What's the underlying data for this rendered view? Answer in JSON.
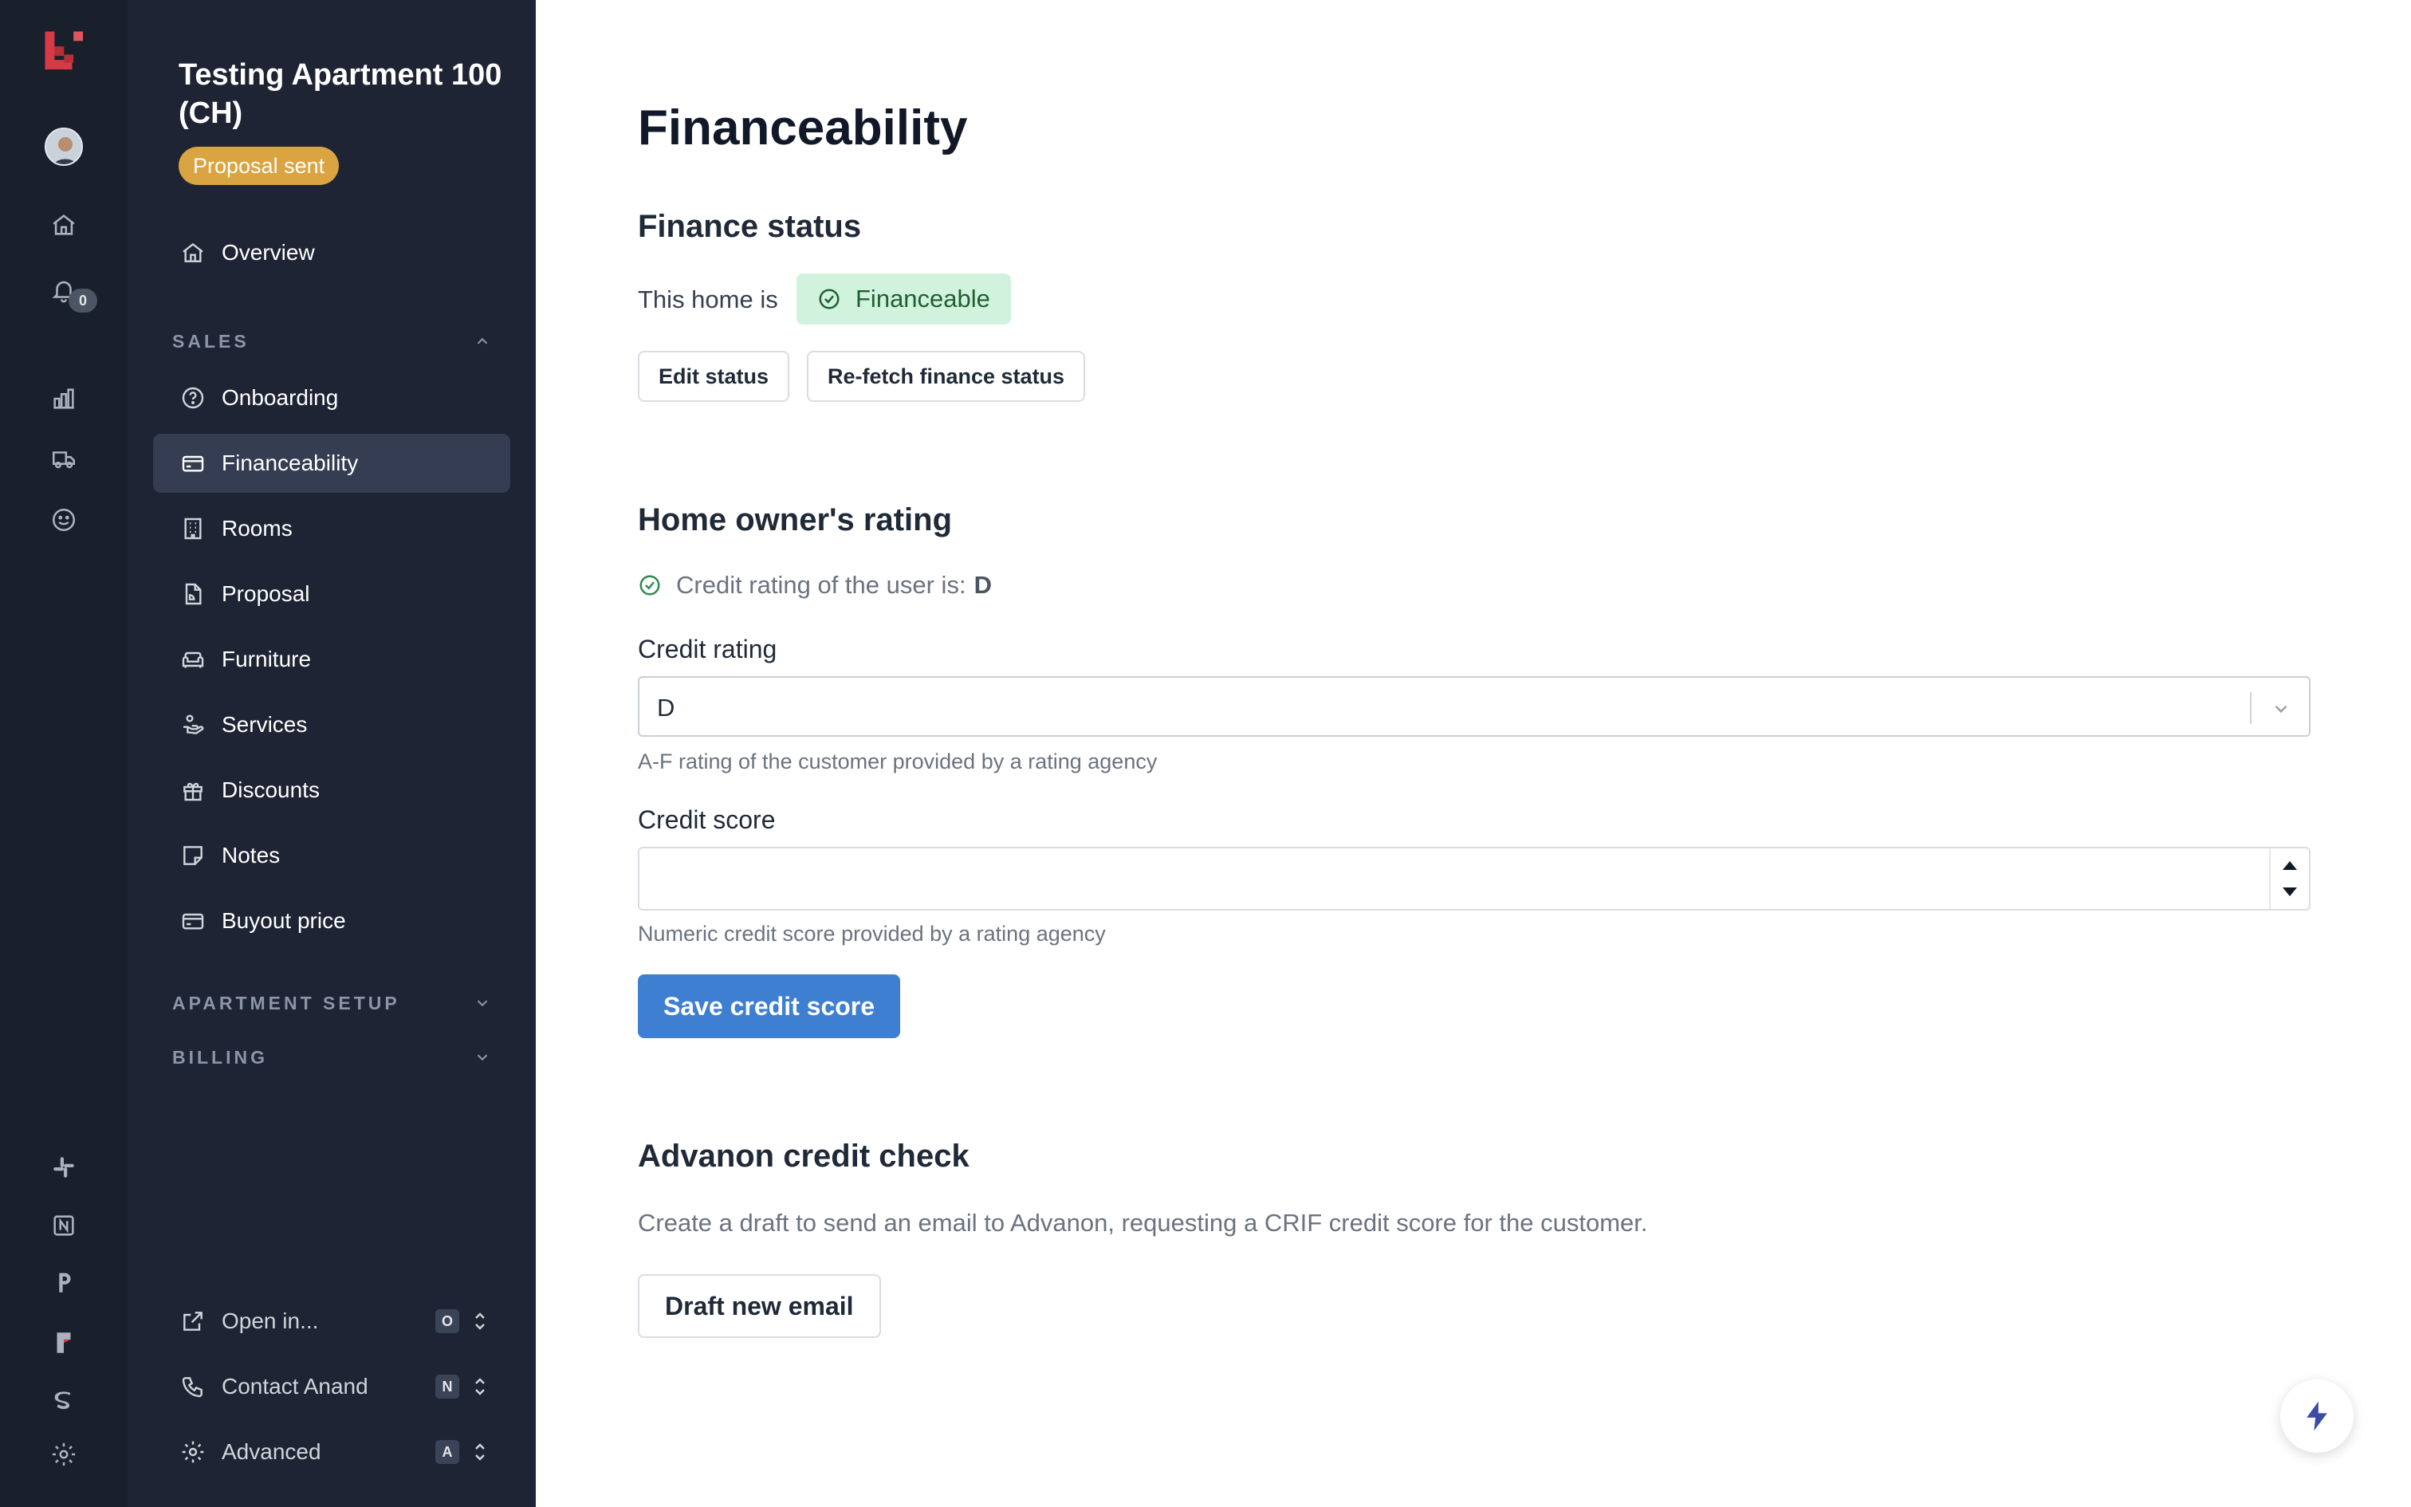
{
  "sidebar": {
    "title": "Testing Apartment 100 (CH)",
    "status_pill": "Proposal sent",
    "rail_notification_count": "0",
    "overview": "Overview",
    "sales_header": "SALES",
    "items": [
      {
        "label": "Onboarding"
      },
      {
        "label": "Financeability"
      },
      {
        "label": "Rooms"
      },
      {
        "label": "Proposal"
      },
      {
        "label": "Furniture"
      },
      {
        "label": "Services"
      },
      {
        "label": "Discounts"
      },
      {
        "label": "Notes"
      },
      {
        "label": "Buyout price"
      }
    ],
    "apartment_setup_header": "APARTMENT SETUP",
    "billing_header": "BILLING",
    "bottom": [
      {
        "label": "Open in...",
        "key": "O"
      },
      {
        "label": "Contact Anand",
        "key": "N"
      },
      {
        "label": "Advanced",
        "key": "A"
      }
    ]
  },
  "main": {
    "title": "Financeability",
    "finance_status": {
      "heading": "Finance status",
      "prefix": "This home is",
      "badge": "Financeable",
      "edit_button": "Edit status",
      "refetch_button": "Re-fetch finance status"
    },
    "rating": {
      "heading": "Home owner's rating",
      "credit_line_prefix": "Credit rating of the user is:",
      "credit_line_value": "D",
      "credit_rating_label": "Credit rating",
      "credit_rating_value": "D",
      "credit_rating_help": "A-F rating of the customer provided by a rating agency",
      "credit_score_label": "Credit score",
      "credit_score_value": "",
      "credit_score_help": "Numeric credit score provided by a rating agency",
      "save_button": "Save credit score"
    },
    "advanon": {
      "heading": "Advanon credit check",
      "description": "Create a draft to send an email to Advanon, requesting a CRIF credit score for the customer.",
      "draft_button": "Draft new email"
    }
  },
  "colors": {
    "rail_bg": "#1a1f2c",
    "sidebar_bg": "#1e2433",
    "active_item_bg": "#343d52",
    "pill": "#d9a441",
    "success_bg": "#d1f2dc",
    "success_text": "#1f5f34",
    "primary": "#3f7fd1",
    "brand_red": "#d63a45"
  }
}
